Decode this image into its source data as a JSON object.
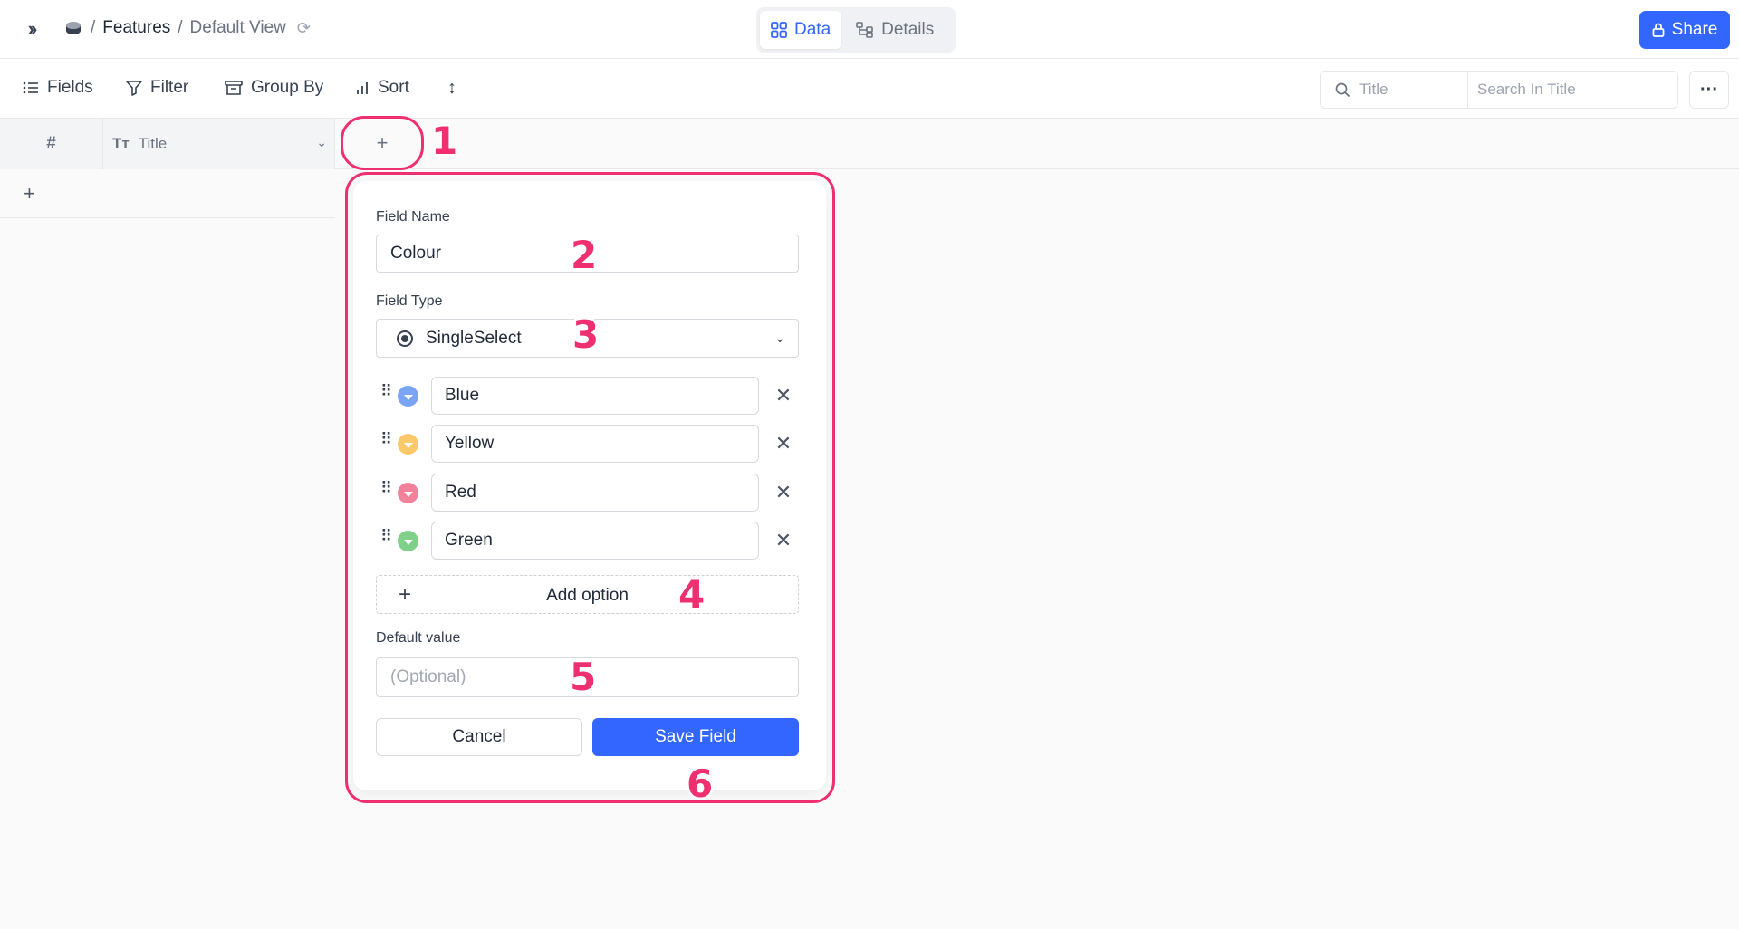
{
  "breadcrumb": {
    "separator": "/",
    "project": "Features",
    "view": "Default View"
  },
  "view_tabs": [
    {
      "label": "Data",
      "icon": "grid-icon",
      "active": true
    },
    {
      "label": "Details",
      "icon": "schema-icon",
      "active": false
    }
  ],
  "share": {
    "label": "Share",
    "icon": "lock-icon"
  },
  "toolbar": {
    "fields_label": "Fields",
    "filter_label": "Filter",
    "group_by_label": "Group By",
    "sort_label": "Sort",
    "search_field_label": "Title",
    "search_placeholder": "Search In Title",
    "more_label": "···"
  },
  "grid": {
    "row_number_header": "#",
    "title_column_header": "Title",
    "title_column_icon": "Tт",
    "add_column_symbol": "+",
    "add_row_symbol": "+"
  },
  "field_editor": {
    "field_name_label": "Field Name",
    "field_name_value": "Colour",
    "field_type_label": "Field Type",
    "field_type_value": "SingleSelect",
    "options": [
      {
        "label": "Blue",
        "color": "#7aa5f5"
      },
      {
        "label": "Yellow",
        "color": "#fbc86a"
      },
      {
        "label": "Red",
        "color": "#f3819a"
      },
      {
        "label": "Green",
        "color": "#7fd18a"
      }
    ],
    "add_option_label": "Add option",
    "default_value_label": "Default value",
    "default_value_placeholder": "(Optional)",
    "cancel_label": "Cancel",
    "save_label": "Save Field"
  },
  "annotations": [
    "1",
    "2",
    "3",
    "4",
    "5",
    "6"
  ],
  "colors": {
    "accent": "#3366ff",
    "annotation": "#ee2f70"
  }
}
